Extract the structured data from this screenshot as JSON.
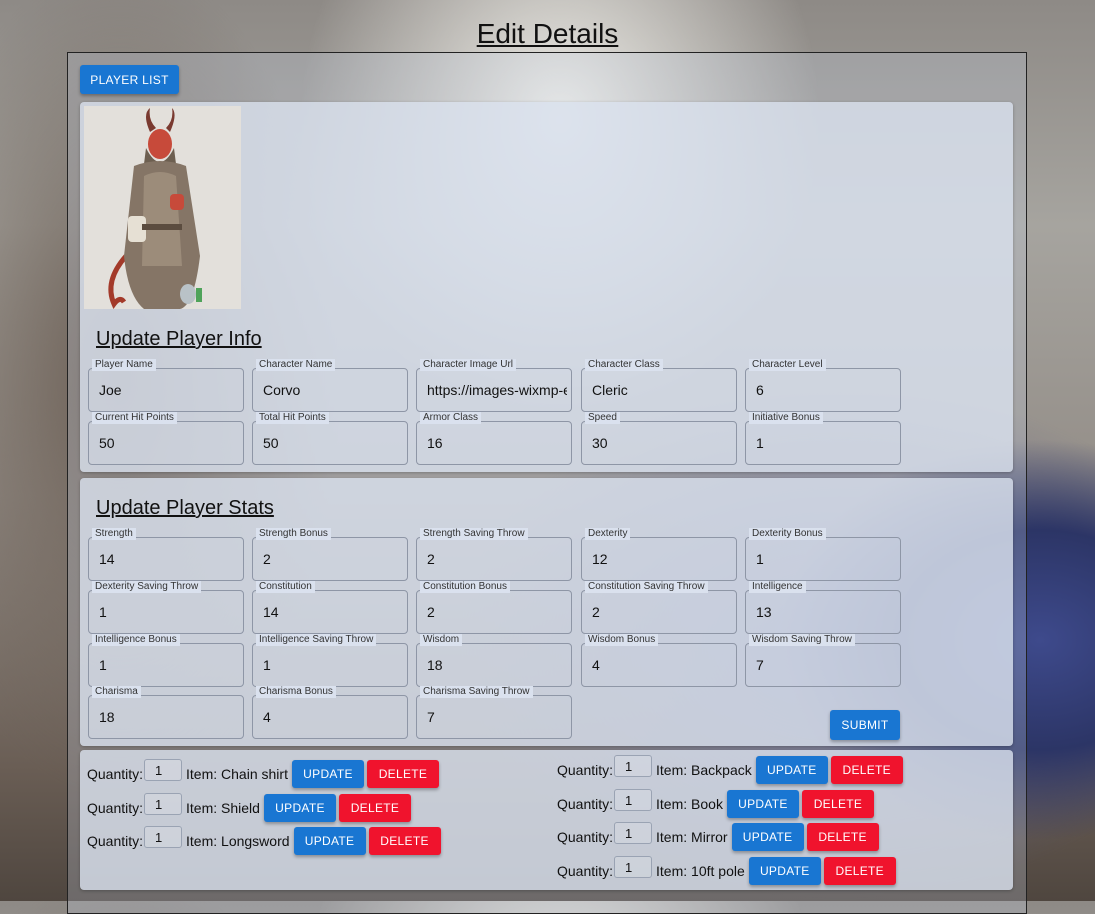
{
  "page": {
    "title": "Edit Details"
  },
  "nav": {
    "player_list": "PLAYER LIST"
  },
  "info": {
    "title": "Update Player Info",
    "portrait_alt": "character-portrait",
    "fields": [
      {
        "label": "Player Name",
        "value": "Joe"
      },
      {
        "label": "Character Name",
        "value": "Corvo"
      },
      {
        "label": "Character Image Url",
        "value": "https://images-wixmp-e"
      },
      {
        "label": "Character Class",
        "value": "Cleric"
      },
      {
        "label": "Character Level",
        "value": "6"
      },
      {
        "label": "Current Hit Points",
        "value": "50"
      },
      {
        "label": "Total Hit Points",
        "value": "50"
      },
      {
        "label": "Armor Class",
        "value": "16"
      },
      {
        "label": "Speed",
        "value": "30"
      },
      {
        "label": "Initiative Bonus",
        "value": "1"
      }
    ]
  },
  "stats": {
    "title": "Update Player Stats",
    "submit": "SUBMIT",
    "fields": [
      {
        "label": "Strength",
        "value": "14"
      },
      {
        "label": "Strength Bonus",
        "value": "2"
      },
      {
        "label": "Strength Saving Throw",
        "value": "2"
      },
      {
        "label": "Dexterity",
        "value": "12"
      },
      {
        "label": "Dexterity Bonus",
        "value": "1"
      },
      {
        "label": "Dexterity Saving Throw",
        "value": "1"
      },
      {
        "label": "Constitution",
        "value": "14"
      },
      {
        "label": "Constitution Bonus",
        "value": "2"
      },
      {
        "label": "Constitution Saving Throw",
        "value": "2"
      },
      {
        "label": "Intelligence",
        "value": "13"
      },
      {
        "label": "Intelligence Bonus",
        "value": "1"
      },
      {
        "label": "Intelligence Saving Throw",
        "value": "1"
      },
      {
        "label": "Wisdom",
        "value": "18"
      },
      {
        "label": "Wisdom Bonus",
        "value": "4"
      },
      {
        "label": "Wisdom Saving Throw",
        "value": "7"
      },
      {
        "label": "Charisma",
        "value": "18"
      },
      {
        "label": "Charisma Bonus",
        "value": "4"
      },
      {
        "label": "Charisma Saving Throw",
        "value": "7"
      }
    ]
  },
  "inventory": {
    "quantity_label": "Quantity:",
    "update_label": "UPDATE",
    "delete_label": "DELETE",
    "left": [
      {
        "qty": "1",
        "item": "Item: Chain shirt"
      },
      {
        "qty": "1",
        "item": "Item: Shield"
      },
      {
        "qty": "1",
        "item": "Item: Longsword"
      }
    ],
    "right": [
      {
        "qty": "1",
        "item": "Item: Backpack"
      },
      {
        "qty": "1",
        "item": "Item: Book"
      },
      {
        "qty": "1",
        "item": "Item: Mirror"
      },
      {
        "qty": "1",
        "item": "Item: 10ft pole"
      }
    ]
  }
}
